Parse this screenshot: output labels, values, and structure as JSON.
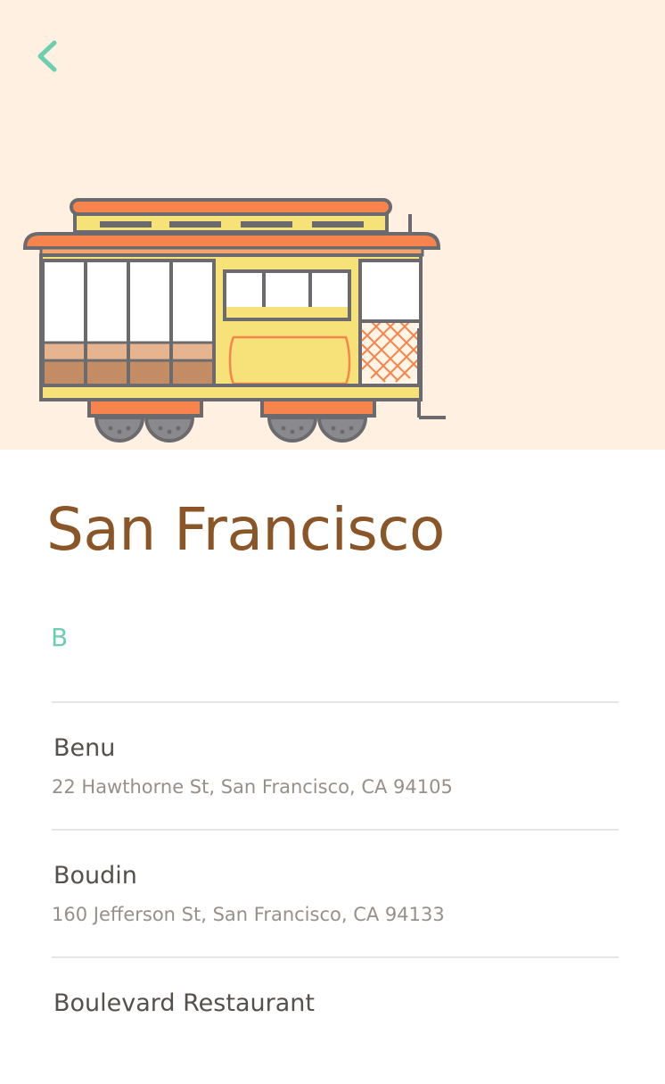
{
  "header": {
    "back_icon": "chevron-left-icon",
    "illustration": "cable-car-illustration",
    "background_color": "#fff0e1",
    "accent_color": "#6dcfaf"
  },
  "city": {
    "name": "San Francisco",
    "title_color": "#8a5527"
  },
  "sections": [
    {
      "letter": "B",
      "restaurants": [
        {
          "name": "Benu",
          "address": "22 Hawthorne St, San Francisco, CA 94105"
        },
        {
          "name": "Boudin",
          "address": "160 Jefferson St, San Francisco, CA 94133"
        },
        {
          "name": "Boulevard Restaurant",
          "address": ""
        }
      ]
    }
  ]
}
